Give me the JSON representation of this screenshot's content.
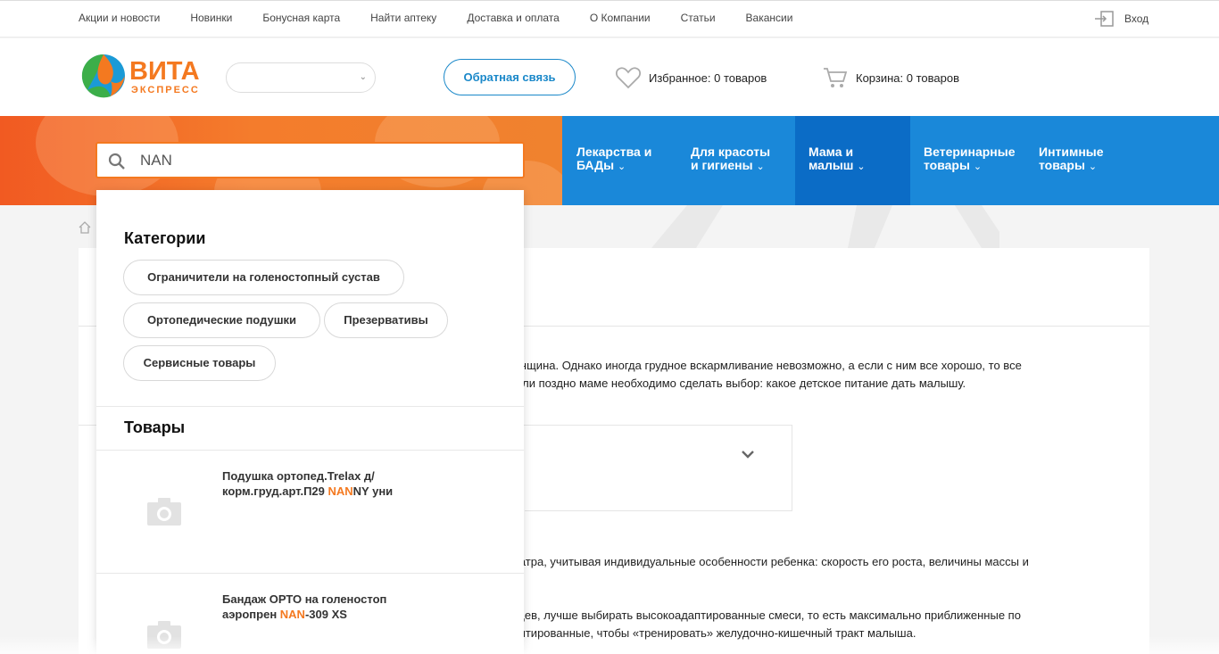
{
  "topnav": {
    "items": [
      "Акции и новости",
      "Новинки",
      "Бонусная карта",
      "Найти аптеку",
      "Доставка и оплата",
      "О Компании",
      "Статьи",
      "Вакансии"
    ],
    "login_label": "Вход"
  },
  "header": {
    "logo_main": "ВИТА",
    "logo_sub": "ЭКСПРЕСС",
    "city_value": "",
    "feedback_label": "Обратная связь",
    "favorites_label": "Избранное: 0 товаров",
    "cart_label": "Корзина: 0 товаров"
  },
  "menu": {
    "items": [
      {
        "line1": "Лекарства и",
        "line2": "БАДы"
      },
      {
        "line1": "Для красоты",
        "line2": "и гигиены"
      },
      {
        "line1": "Мама и",
        "line2": "малыш"
      },
      {
        "line1": "Ветеринарные",
        "line2": "товары"
      },
      {
        "line1": "Интимные",
        "line2": "товары"
      }
    ]
  },
  "search": {
    "value": "NAN"
  },
  "dropdown": {
    "categories_title": "Категории",
    "categories": [
      "Ограничители на голеностопный сустав",
      "Ортопедические подушки",
      "Презервативы",
      "Сервисные товары"
    ],
    "products_title": "Товары",
    "products": [
      {
        "line1": "Подушка ортопед.Trelax д/",
        "line2_pre": "корм.груд.арт.П29 ",
        "highlight": "NAN",
        "line2_post": "NY уни"
      },
      {
        "line1": "Бандаж ОРТО на голеностоп",
        "line2_pre": "аэропрен ",
        "highlight": "NAN",
        "line2_post": "-309 XS"
      }
    ]
  },
  "article": {
    "p1_line1": "женщина. Однако иногда грудное вскармливание невозможно, а если с ним все хорошо, то все",
    "p1_line2": "о или поздно маме необходимо сделать выбор: какое детское питание дать малышу.",
    "p2_line1": "диатра, учитывая индивидуальные особенности ребенка: скорость его роста, величины массы и",
    "p3_line1": "сяцев, лучше выбирать высокоадаптированные смеси, то есть максимально приближенные по",
    "p3_line2": "даптированные, чтобы «тренировать» желудочно-кишечный тракт малыша."
  },
  "colors": {
    "brand_orange": "#f47920",
    "menu_blue": "#1a88d9",
    "menu_active": "#0b6cc6",
    "link_blue": "#1a88c9"
  }
}
